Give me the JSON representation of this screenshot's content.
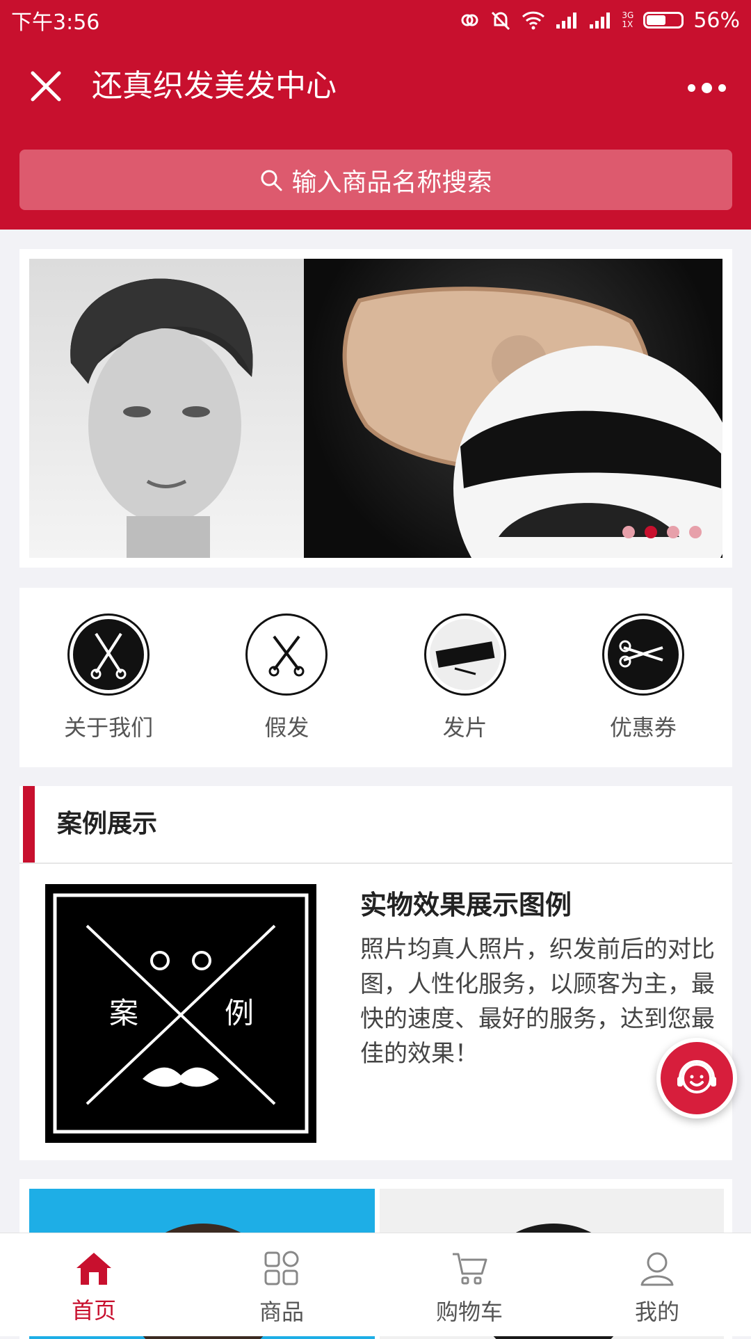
{
  "status_bar": {
    "time": "下午3:56",
    "network": "3G",
    "sim": "1X",
    "battery_percent": "56%",
    "battery_level": 0.56
  },
  "header": {
    "title": "还真织发美发中心",
    "search_placeholder": "输入商品名称搜索"
  },
  "banner": {
    "slide_count": 4,
    "active_index": 1
  },
  "categories": [
    {
      "label": "关于我们",
      "icon": "about-us-scissors-icon"
    },
    {
      "label": "假发",
      "icon": "wig-scissors-icon"
    },
    {
      "label": "发片",
      "icon": "hair-piece-icon"
    },
    {
      "label": "优惠券",
      "icon": "coupon-scissors-icon"
    }
  ],
  "case_section": {
    "title": "案例展示",
    "item": {
      "title": "实物效果展示图例",
      "description": "照片均真人照片，织发前后的对比图，人性化服务，以顾客为主，最快的速度、最好的服务，达到您最佳的效果！",
      "image_text_left": "案",
      "image_text_right": "例"
    }
  },
  "tabbar": {
    "items": [
      {
        "label": "首页",
        "icon": "home-icon",
        "active": true
      },
      {
        "label": "商品",
        "icon": "grid-icon",
        "active": false
      },
      {
        "label": "购物车",
        "icon": "cart-icon",
        "active": false
      },
      {
        "label": "我的",
        "icon": "user-icon",
        "active": false
      }
    ]
  },
  "colors": {
    "brand": "#c8102e",
    "search_bg": "#dd5a6e",
    "background": "#f2f2f6"
  }
}
